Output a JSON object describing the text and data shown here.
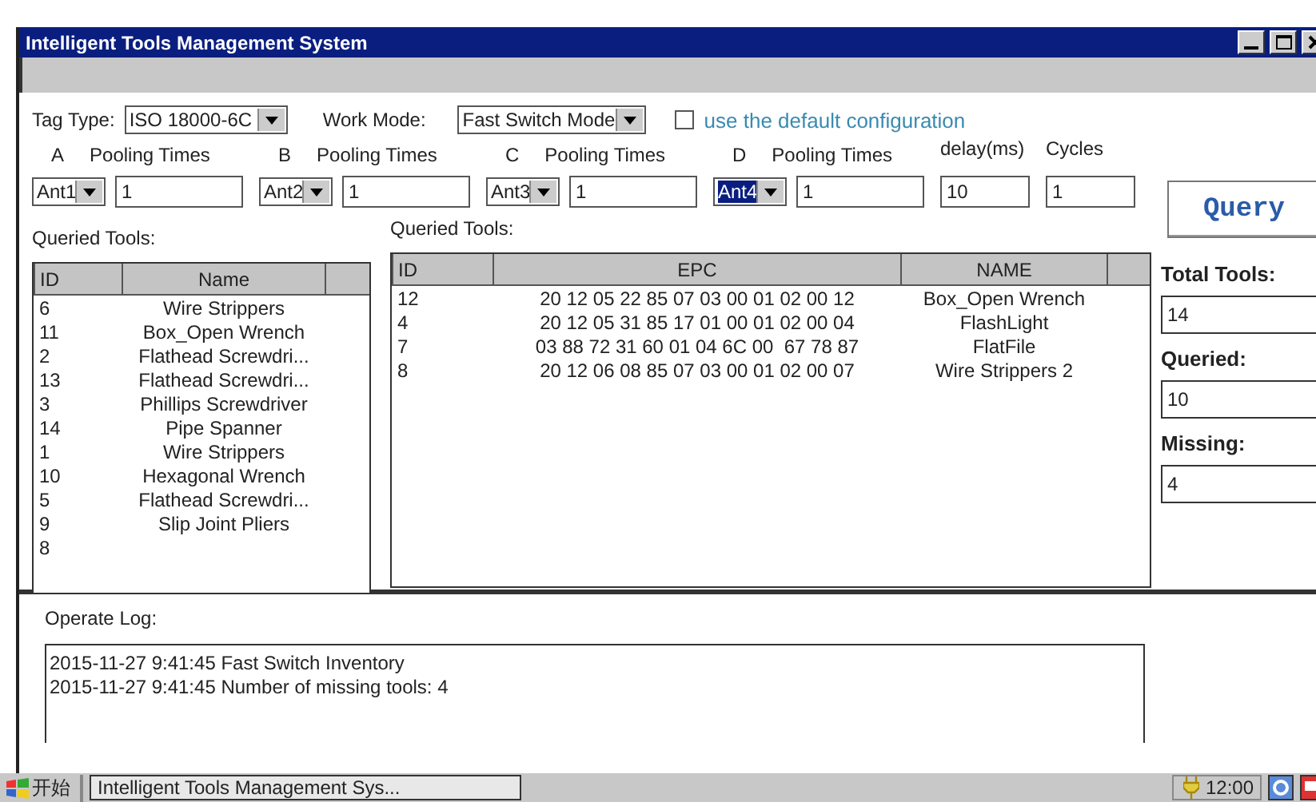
{
  "window": {
    "title": "Intelligent Tools Management System"
  },
  "tag_type": {
    "label": "Tag Type:",
    "value": "ISO 18000-6C"
  },
  "work_mode": {
    "label": "Work Mode:",
    "value": "Fast Switch Mode"
  },
  "default_config": {
    "label": "use the default configuration",
    "checked": false
  },
  "antennas": [
    {
      "letter": "A",
      "times_label": "Pooling Times",
      "port": "Ant1",
      "times": "1",
      "selected": false
    },
    {
      "letter": "B",
      "times_label": "Pooling Times",
      "port": "Ant2",
      "times": "1",
      "selected": false
    },
    {
      "letter": "C",
      "times_label": "Pooling Times",
      "port": "Ant3",
      "times": "1",
      "selected": false
    },
    {
      "letter": "D",
      "times_label": "Pooling Times",
      "port": "Ant4",
      "times": "1",
      "selected": true
    }
  ],
  "delay": {
    "label": "delay(ms)",
    "value": "10"
  },
  "cycles": {
    "label": "Cycles",
    "value": "1"
  },
  "query_button": "Query",
  "all_tools": {
    "label": "Queried Tools:",
    "columns": [
      "ID",
      "Name"
    ],
    "rows": [
      [
        "6",
        "Wire Strippers"
      ],
      [
        "11",
        "Box_Open Wrench"
      ],
      [
        "2",
        "Flathead Screwdri..."
      ],
      [
        "13",
        "Flathead Screwdri..."
      ],
      [
        "3",
        "Phillips Screwdriver"
      ],
      [
        "14",
        "Pipe Spanner"
      ],
      [
        "1",
        "Wire Strippers"
      ],
      [
        "10",
        "Hexagonal Wrench"
      ],
      [
        "5",
        "Flathead Screwdri..."
      ],
      [
        "9",
        "Slip Joint Pliers"
      ],
      [
        "8",
        ""
      ]
    ]
  },
  "queried_tools": {
    "label": "Queried Tools:",
    "columns": [
      "ID",
      "EPC",
      "NAME"
    ],
    "rows": [
      [
        "12",
        "20 12 05 22 85 07 03 00 01 02 00 12",
        "Box_Open Wrench"
      ],
      [
        "4",
        "20 12 05 31 85 17 01 00 01 02 00 04",
        "FlashLight"
      ],
      [
        "7",
        "03 88 72 31 60 01 04 6C 00  67 78 87",
        "FlatFile"
      ],
      [
        "8",
        "20 12 06 08 85 07 03 00 01 02 00 07",
        "Wire Strippers 2"
      ]
    ]
  },
  "stats": [
    {
      "label": "Total Tools:",
      "value": "14"
    },
    {
      "label": "Queried:",
      "value": "10"
    },
    {
      "label": "Missing:",
      "value": "4"
    }
  ],
  "log": {
    "label": "Operate Log:",
    "lines": [
      "2015-11-27 9:41:45 Fast Switch Inventory",
      "2015-11-27 9:41:45 Number of missing tools: 4"
    ]
  },
  "taskbar": {
    "start": "开始",
    "task": "Intelligent Tools Management Sys...",
    "clock": "12:00"
  }
}
